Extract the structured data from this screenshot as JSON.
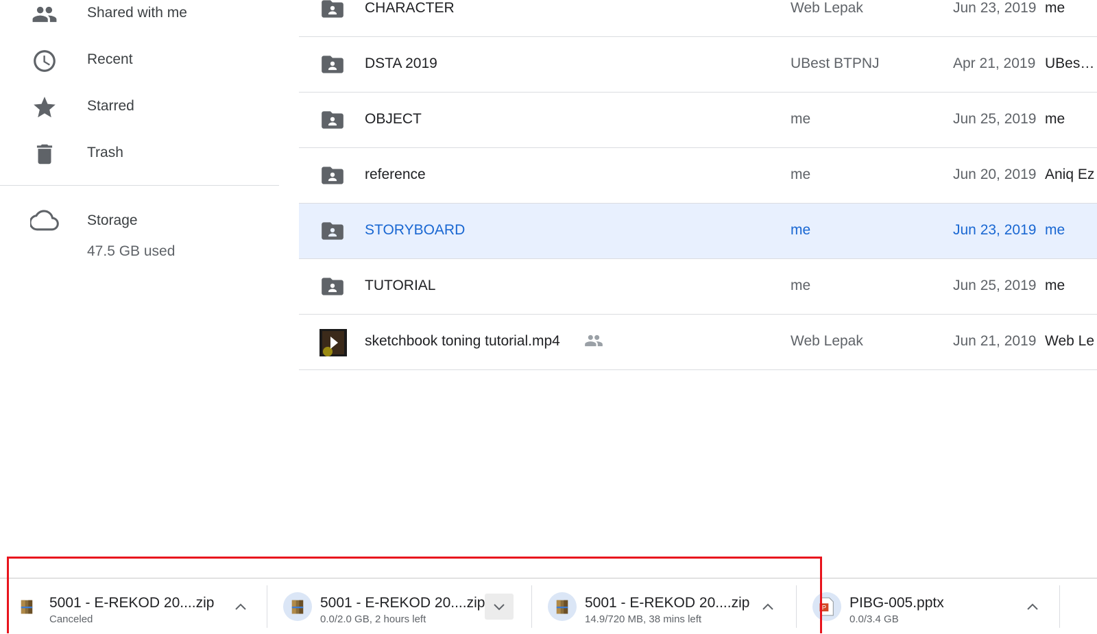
{
  "sidebar": {
    "items": [
      {
        "label": "Shared with me",
        "icon": "people-icon"
      },
      {
        "label": "Recent",
        "icon": "clock-icon"
      },
      {
        "label": "Starred",
        "icon": "star-icon"
      },
      {
        "label": "Trash",
        "icon": "trash-icon"
      }
    ],
    "storage": {
      "label": "Storage",
      "icon": "cloud-icon",
      "used": "47.5 GB used"
    }
  },
  "files": [
    {
      "name": "CHARACTER",
      "owner": "Web Lepak",
      "modified": "Jun 23, 2019",
      "modified_by": "me",
      "icon": "shared-folder-icon"
    },
    {
      "name": "DSTA 2019",
      "owner": "UBest BTPNJ",
      "modified": "Apr 21, 2019",
      "modified_by": "UBest ...",
      "icon": "shared-folder-icon"
    },
    {
      "name": "OBJECT",
      "owner": "me",
      "modified": "Jun 25, 2019",
      "modified_by": "me",
      "icon": "shared-folder-icon"
    },
    {
      "name": "reference",
      "owner": "me",
      "modified": "Jun 20, 2019",
      "modified_by": "Aniq Ez",
      "icon": "shared-folder-icon"
    },
    {
      "name": "STORYBOARD",
      "owner": "me",
      "modified": "Jun 23, 2019",
      "modified_by": "me",
      "icon": "shared-folder-icon",
      "selected": true
    },
    {
      "name": "TUTORIAL",
      "owner": "me",
      "modified": "Jun 25, 2019",
      "modified_by": "me",
      "icon": "shared-folder-icon"
    },
    {
      "name": "sketchbook toning tutorial.mp4",
      "owner": "Web Lepak",
      "modified": "Jun 21, 2019",
      "modified_by": "Web Le",
      "icon": "video-thumbnail-icon",
      "shared": true
    }
  ],
  "downloads": [
    {
      "name": "5001 - E-REKOD 20....zip",
      "status": "Canceled",
      "icon": "archive-icon",
      "chevron": "up"
    },
    {
      "name": "5001 - E-REKOD 20....zip",
      "status": "0.0/2.0 GB, 2 hours left",
      "icon": "archive-icon",
      "chevron": "down",
      "progress": 0.0
    },
    {
      "name": "5001 - E-REKOD 20....zip",
      "status": "14.9/720 MB, 38 mins left",
      "icon": "archive-icon",
      "chevron": "up",
      "progress": 0.021
    },
    {
      "name": "PIBG-005.pptx",
      "status": "0.0/3.4 GB",
      "icon": "pptx-icon",
      "chevron": "up",
      "progress": 0.0
    }
  ],
  "colors": {
    "selected_bg": "#e8f0fe",
    "selected_text": "#1967d2",
    "highlight_border": "#e8141d"
  }
}
